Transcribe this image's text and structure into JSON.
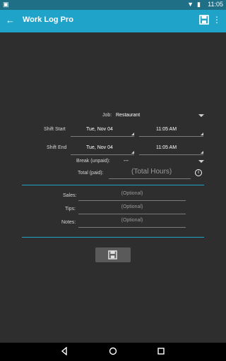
{
  "statusbar": {
    "time": "11:05"
  },
  "appbar": {
    "title": "Work Log Pro"
  },
  "form": {
    "job_label": "Job:",
    "job_value": "Restaurant",
    "shift_start_label": "Shift Start",
    "shift_start_date": "Tue, Nov 04",
    "shift_start_time": "11:05 AM",
    "shift_end_label": "Shift End",
    "shift_end_date": "Tue, Nov 04",
    "shift_end_time": "11:05 AM",
    "break_label": "Break (unpaid):",
    "break_value": "---",
    "total_label": "Total (paid):",
    "total_placeholder": "(Total Hours)",
    "sales_label": "Sales:",
    "tips_label": "Tips:",
    "notes_label": "Notes:",
    "optional_placeholder": "(Optional)"
  },
  "icons": {
    "back": "arrow-back-icon",
    "save": "save-icon",
    "more": "more-vert-icon",
    "info": "info-icon",
    "nav_back": "nav-back-icon",
    "nav_home": "nav-home-icon",
    "nav_recent": "nav-recent-icon"
  },
  "colors": {
    "accent": "#1fa3c9",
    "background": "#2e2e2e",
    "statusbar": "#1f6f87"
  }
}
